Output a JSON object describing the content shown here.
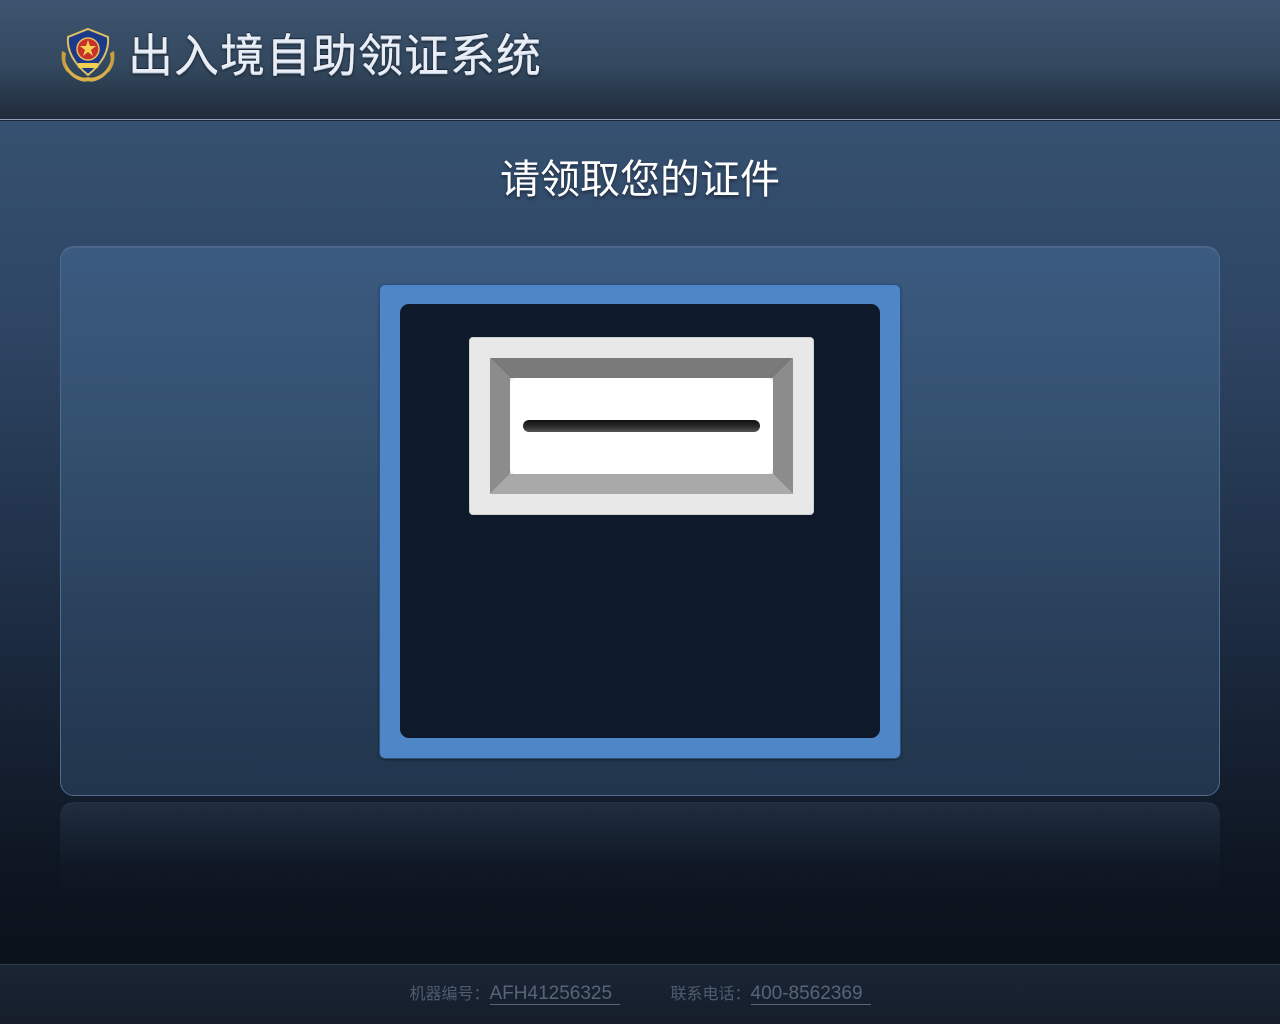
{
  "header": {
    "app_title": "出入境自助领证系统",
    "emblem_icon": "police-emblem-icon"
  },
  "main": {
    "page_title": "请领取您的证件",
    "slot_icon": "card-slot-icon"
  },
  "footer": {
    "machine_label": "机器编号：",
    "machine_id": "AFH41256325",
    "phone_label": "联系电话：",
    "phone_number": "400-8562369"
  },
  "colors": {
    "slot_frame": "#4f86c8",
    "slot_screen": "#0e1a29",
    "header_bg": "#34495f"
  }
}
